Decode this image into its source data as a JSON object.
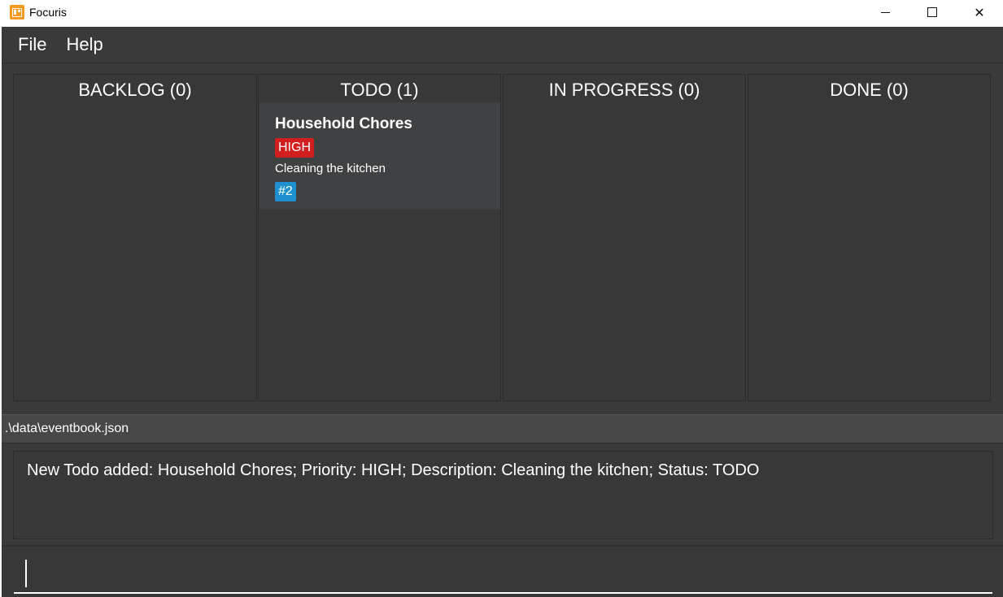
{
  "window": {
    "title": "Focuris",
    "app_icon": "focuris-board-icon",
    "controls": [
      "minimize-icon",
      "maximize-icon",
      "close-icon"
    ]
  },
  "menu": {
    "items": [
      {
        "label": "File"
      },
      {
        "label": "Help"
      }
    ]
  },
  "board": {
    "columns": [
      {
        "title": "BACKLOG (0)"
      },
      {
        "title": "TODO (1)"
      },
      {
        "title": "IN PROGRESS (0)"
      },
      {
        "title": "DONE (0)"
      }
    ],
    "card": {
      "title": "Household Chores",
      "priority": "HIGH",
      "description": "Cleaning the kitchen",
      "id": "#2"
    }
  },
  "status": {
    "path": ".\\data\\eventbook.json"
  },
  "result": {
    "message": "New Todo added: Household Chores; Priority: HIGH; Description: Cleaning the kitchen; Status: TODO"
  },
  "command": {
    "value": ""
  },
  "colors": {
    "background": "#3a3a3a",
    "priority_high": "#d11f1f",
    "id_badge": "#1e8fcf",
    "app_icon": "#f59a1e"
  }
}
